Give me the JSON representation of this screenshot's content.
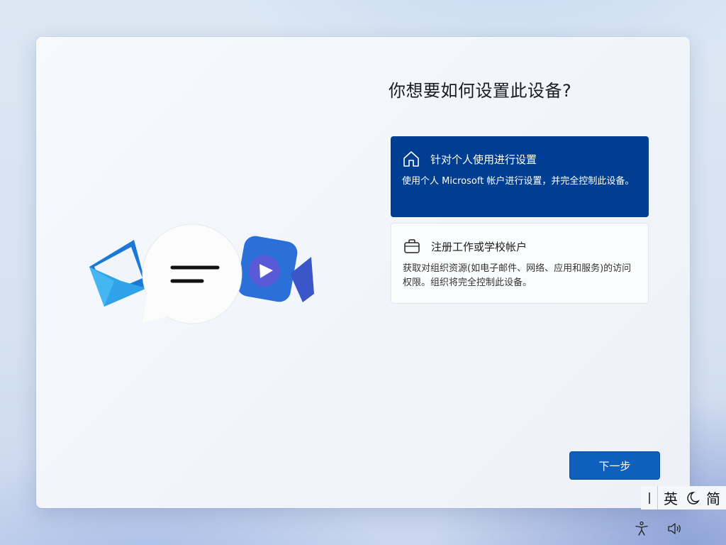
{
  "dialog": {
    "heading": "你想要如何设置此设备?",
    "options": [
      {
        "title": "针对个人使用进行设置",
        "description": "使用个人 Microsoft 帐户进行设置，并完全控制此设备。",
        "icon": "home-icon",
        "selected": true
      },
      {
        "title": "注册工作或学校帐户",
        "description": "获取对组织资源(如电子邮件、网络、应用和服务)的访问权限。组织将完全控制此设备。",
        "icon": "briefcase-icon",
        "selected": false
      }
    ],
    "next_button_label": "下一步"
  },
  "ime_bar": {
    "language_label": "英",
    "mode_icon": "moon-icon",
    "script_label": "简"
  },
  "tray": {
    "accessibility_icon": "accessibility-icon",
    "volume_icon": "volume-icon"
  },
  "colors": {
    "selected_option_bg": "#003e92",
    "next_button_bg": "#0f5fbd"
  }
}
